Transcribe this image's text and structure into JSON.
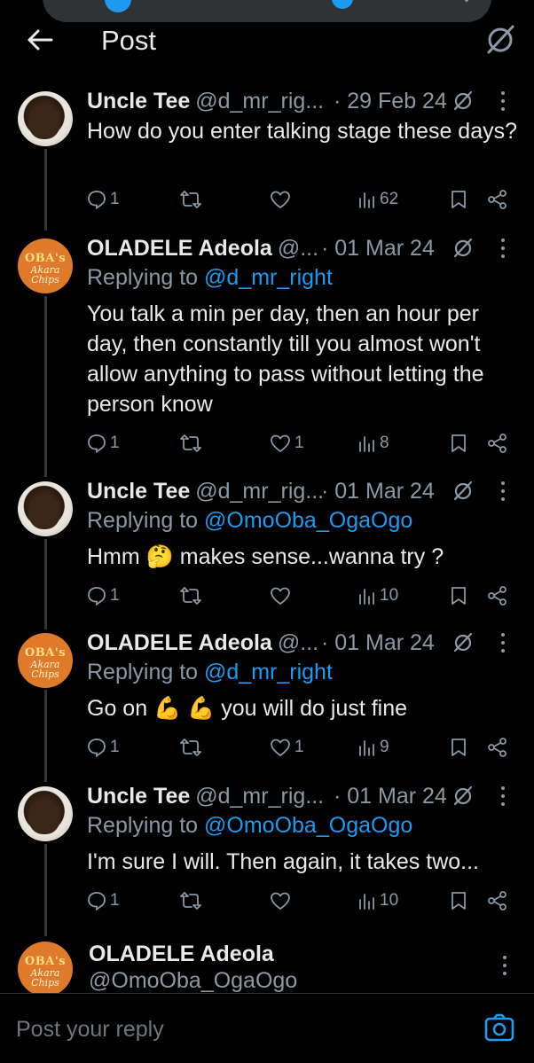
{
  "header": {
    "title": "Post"
  },
  "posts": [
    {
      "name": "Uncle Tee",
      "handle": "@d_mr_rig...",
      "date": "· 29 Feb 24",
      "replying_to": null,
      "text": "How do you enter talking stage these days?",
      "replies": "1",
      "likes": "",
      "views": "62",
      "avatar": "uncle-tee"
    },
    {
      "name": "OLADELE Adeola",
      "handle": "@...",
      "date": "· 01 Mar 24",
      "replying_label": "Replying to",
      "replying_to": "@d_mr_right",
      "text": "You talk a min per day, then an hour per day, then constantly till you almost won't allow anything to pass without letting the person know",
      "replies": "1",
      "likes": "1",
      "views": "8",
      "avatar": "oba"
    },
    {
      "name": "Uncle Tee",
      "handle": "@d_mr_rig...",
      "date": "· 01 Mar 24",
      "replying_label": "Replying to",
      "replying_to": "@OmoOba_OgaOgo",
      "text_before": "Hmm ",
      "emoji": "🤔",
      "text_after": " makes sense...wanna try ?",
      "replies": "1",
      "likes": "",
      "views": "10",
      "avatar": "uncle-tee"
    },
    {
      "name": "OLADELE Adeola",
      "handle": "@...",
      "date": "· 01 Mar 24",
      "replying_label": "Replying to",
      "replying_to": "@d_mr_right",
      "text_before": "Go on ",
      "emoji": "💪 💪",
      "text_after": " you will do just fine",
      "replies": "1",
      "likes": "1",
      "views": "9",
      "avatar": "oba"
    },
    {
      "name": "Uncle Tee",
      "handle": "@d_mr_rig...",
      "date": "· 01 Mar 24",
      "replying_label": "Replying to",
      "replying_to": "@OmoOba_OgaOgo",
      "text": "I'm sure I will. Then again, it takes two...",
      "replies": "1",
      "likes": "",
      "views": "10",
      "avatar": "uncle-tee"
    }
  ],
  "reply_author": {
    "name": "OLADELE Adeola",
    "handle": "@OmoOba_OgaOgo"
  },
  "oba_logo": {
    "top": "OBA's",
    "mid": "Akara",
    "bottom": "Chips"
  },
  "reply_bar": {
    "placeholder": "Post your reply"
  },
  "colors": {
    "background": "#000000",
    "accent": "#1d9bf0",
    "muted": "#8b98a5",
    "text": "#e7e9ea"
  },
  "icons": [
    "back-arrow-icon",
    "grok-icon",
    "more-icon",
    "reply-icon",
    "repost-icon",
    "like-icon",
    "views-icon",
    "bookmark-icon",
    "share-icon",
    "camera-icon"
  ]
}
